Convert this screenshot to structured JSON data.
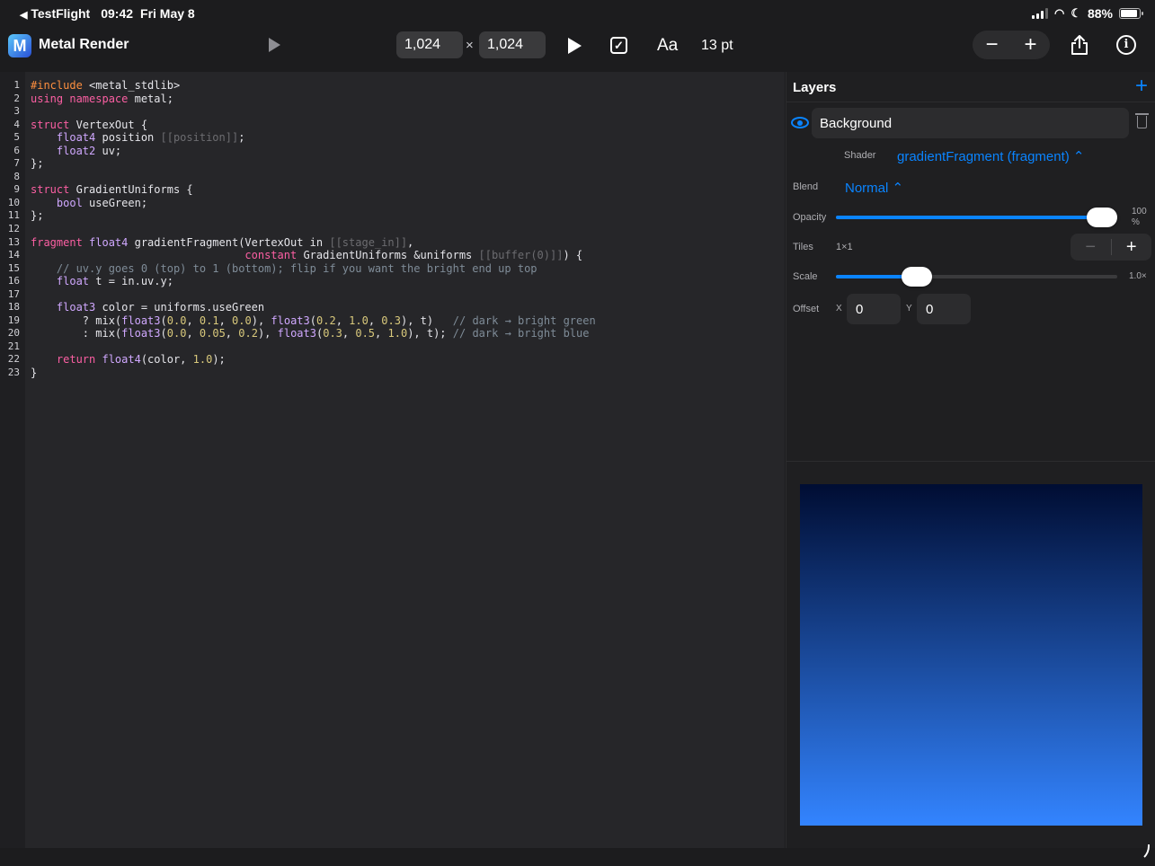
{
  "status_bar": {
    "back_app": "TestFlight",
    "time": "09:42",
    "date": "Fri May 8",
    "battery": "88%"
  },
  "toolbar": {
    "app_title": "Metal Render",
    "width": "1,024",
    "times": "×",
    "height": "1,024",
    "font_label": "Aa",
    "font_size": "13 pt",
    "zoom_out": "−",
    "zoom_in": "+",
    "info": "i"
  },
  "editor": {
    "line_numbers": [
      "1",
      "2",
      "3",
      "4",
      "5",
      "6",
      "7",
      "8",
      "9",
      "10",
      "11",
      "12",
      "13",
      "14",
      "15",
      "16",
      "17",
      "18",
      "19",
      "20",
      "21",
      "22",
      "23"
    ],
    "lines": {
      "l1a": "#include",
      "l1b": " <metal_stdlib>",
      "l2a": "using namespace",
      "l2b": " metal;",
      "l4a": "struct",
      "l4b": " VertexOut {",
      "l5a": "    float4",
      "l5b": " position ",
      "l5c": "[[position]]",
      "l5d": ";",
      "l6a": "    float2",
      "l6b": " uv;",
      "l7": "};",
      "l9a": "struct",
      "l9b": " GradientUniforms {",
      "l10a": "    bool",
      "l10b": " useGreen;",
      "l11": "};",
      "l13a": "fragment",
      "l13b": " float4",
      "l13c": " gradientFragment(VertexOut in ",
      "l13d": "[[stage_in]]",
      "l13e": ",",
      "l14a": "                                 constant",
      "l14b": " GradientUniforms &uniforms ",
      "l14c": "[[buffer(0)]]",
      "l14d": ") {",
      "l15": "    // uv.y goes 0 (top) to 1 (bottom); flip if you want the bright end up top",
      "l16a": "    float",
      "l16b": " t = in.uv.y;",
      "l18a": "    float3",
      "l18b": " color = uniforms.useGreen",
      "l19a": "        ? mix(",
      "l19b": "float3",
      "l19c": "(",
      "l19d": "0.0",
      "l19e": ", ",
      "l19f": "0.1",
      "l19g": ", ",
      "l19h": "0.0",
      "l19i": "), ",
      "l19j": "float3",
      "l19k": "(",
      "l19l": "0.2",
      "l19m": ", ",
      "l19n": "1.0",
      "l19o": ", ",
      "l19p": "0.3",
      "l19q": "), t)   ",
      "l19r": "// dark → bright green",
      "l20a": "        : mix(",
      "l20b": "float3",
      "l20c": "(",
      "l20d": "0.0",
      "l20e": ", ",
      "l20f": "0.05",
      "l20g": ", ",
      "l20h": "0.2",
      "l20i": "), ",
      "l20j": "float3",
      "l20k": "(",
      "l20l": "0.3",
      "l20m": ", ",
      "l20n": "0.5",
      "l20o": ", ",
      "l20p": "1.0",
      "l20q": "), t); ",
      "l20r": "// dark → bright blue",
      "l22a": "    return",
      "l22b": " float4",
      "l22c": "(color, ",
      "l22d": "1.0",
      "l22e": ");",
      "l23": "}"
    }
  },
  "layers_panel": {
    "title": "Layers",
    "add": "+",
    "layer_name": "Background",
    "shader_label": "Shader",
    "shader_value": "gradientFragment (fragment) ⌃",
    "blend_label": "Blend",
    "blend_value": "Normal ⌃",
    "opacity_label": "Opacity",
    "opacity_value": "100",
    "opacity_unit": "%",
    "opacity_level": 1.0,
    "tiles_label": "Tiles",
    "tiles_value": "1×1",
    "scale_label": "Scale",
    "scale_value": "1.0×",
    "scale_level": 0.26,
    "offset_label": "Offset",
    "offset_x_label": "X",
    "offset_x": "0",
    "offset_y_label": "Y",
    "offset_y": "0"
  },
  "colors": {
    "accent": "#0a84ff",
    "preview_top": "#000d33",
    "preview_bottom": "#3384ff"
  }
}
